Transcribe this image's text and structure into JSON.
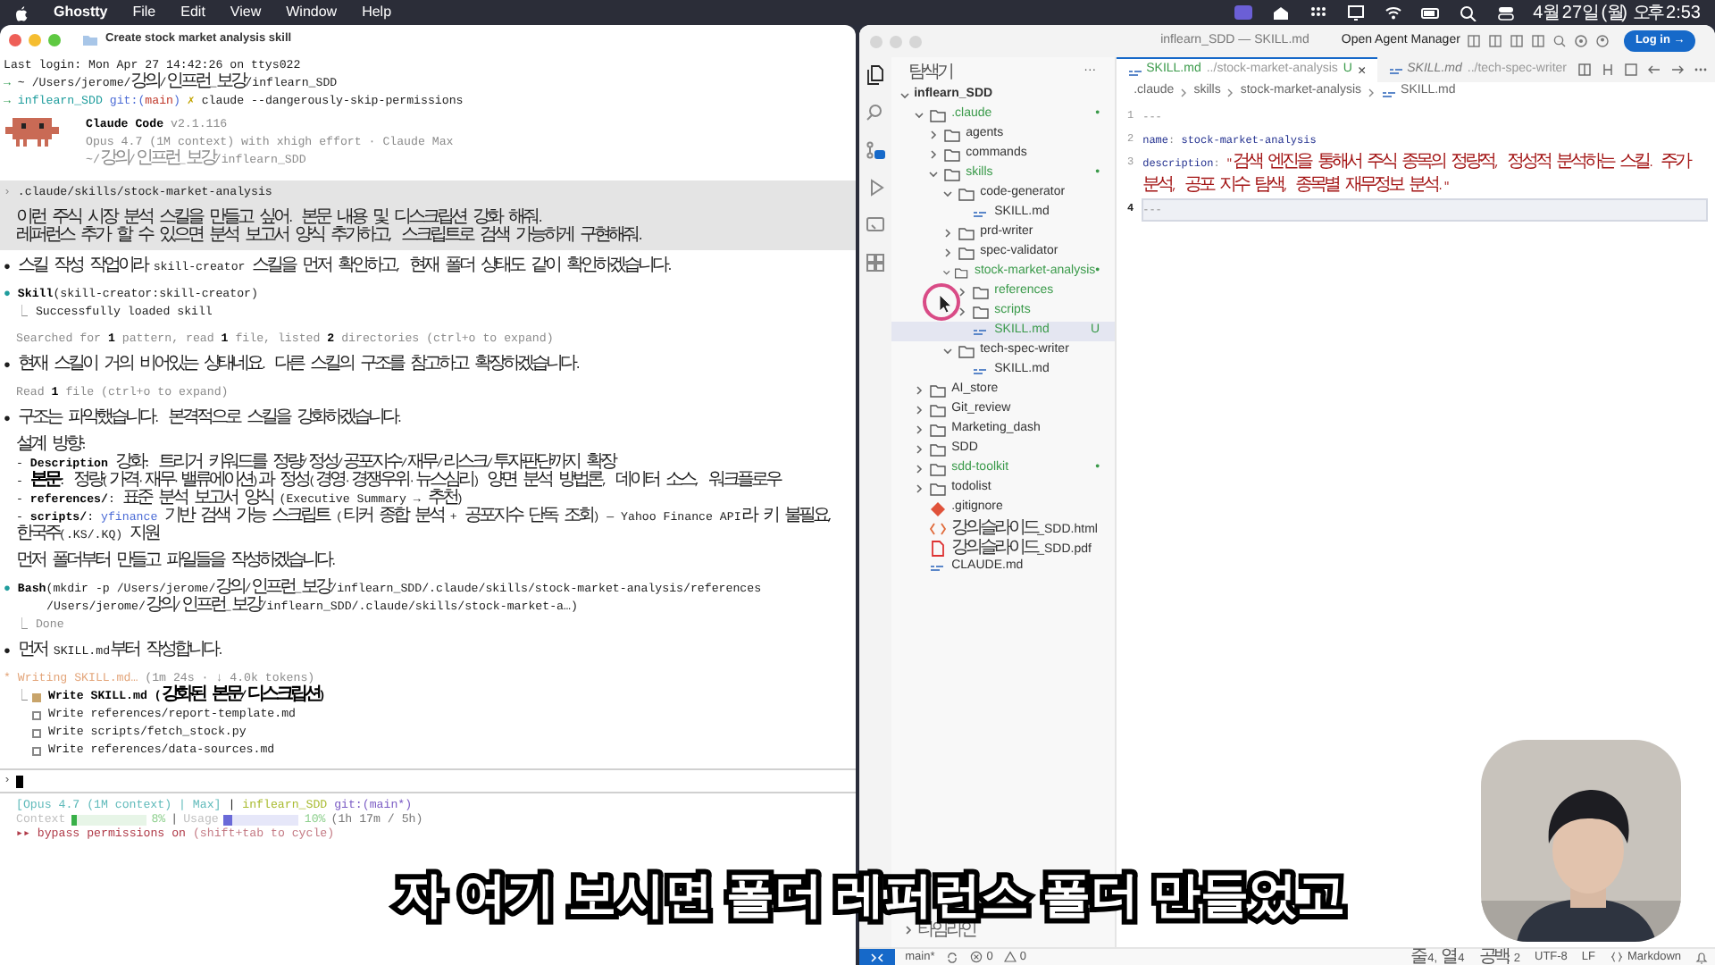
{
  "menubar": {
    "app": "Ghostty",
    "items": [
      "File",
      "Edit",
      "View",
      "Window",
      "Help"
    ],
    "clock": "4월 27일 (월) 오후 2:53"
  },
  "terminal": {
    "title": "Create stock market analysis skill",
    "session": [
      {
        "kind": "flush",
        "segs": [
          {
            "text": "Last login: Mon Apr 27 14:42:26 on ttys022",
            "kind": "plain"
          }
        ]
      },
      {
        "kind": "flush",
        "segs": [
          {
            "text": "→ ",
            "kind": "green"
          },
          {
            "text": "~ /Users/jerome/강의/인프런_보강/inflearn_SDD",
            "kind": "plain"
          }
        ]
      },
      {
        "kind": "flush",
        "segs": [
          {
            "text": "→ ",
            "kind": "green"
          },
          {
            "text": "inflearn_SDD",
            "kind": "teal"
          },
          {
            "text": " git:(",
            "kind": "blue"
          },
          {
            "text": "main",
            "kind": "red"
          },
          {
            "text": ")",
            "kind": "blue"
          },
          {
            "text": " ✗ ",
            "kind": "yellow"
          },
          {
            "text": "claude --dangerously-skip-permissions",
            "kind": "plain"
          }
        ]
      }
    ],
    "banner": [
      {
        "kind": "flush",
        "segs": [
          {
            "text": "Claude Code",
            "kind": "bold"
          },
          {
            "text": " v2.1.116",
            "kind": "dim"
          }
        ]
      },
      {
        "kind": "flush",
        "segs": [
          {
            "text": "Opus 4.7 (1M context) with xhigh effort · Claude Max",
            "kind": "dim"
          }
        ]
      },
      {
        "kind": "flush",
        "segs": [
          {
            "text": "~/강의/인프런_보강/inflearn_SDD",
            "kind": "dim"
          }
        ]
      }
    ],
    "prompt": [
      [
        {
          "kind": "flush",
          "segs": [
            {
              "text": "› ",
              "kind": "dim"
            },
            {
              "text": ".claude/skills/stock-market-analysis",
              "kind": "plain"
            }
          ]
        }
      ],
      [
        {
          "kind": "indent",
          "segs": [
            {
              "text": "이런 주식 시장 분석 스킬을 만들고 싶어. 본문 내용 및 디스크립션 강화 해줘.",
              "kind": "plain"
            }
          ]
        },
        {
          "kind": "indent",
          "segs": [
            {
              "text": "레퍼런스 추가 할 수 있으면 분석 보고서 양식 추가하고, 스크립트로 검색 가능하게 구현해줘.",
              "kind": "plain"
            }
          ]
        }
      ]
    ],
    "blocks": [
      [
        {
          "kind": "flush",
          "segs": [
            {
              "text": "● ",
              "kind": "plain"
            },
            {
              "text": "스킬 작성 작업이라 skill-creator 스킬을 먼저 확인하고, 현재 폴더 상태도 같이 확인하겠습니다.",
              "kind": "plain"
            }
          ]
        }
      ],
      [
        {
          "kind": "flush",
          "segs": [
            {
              "text": "● ",
              "kind": "teal"
            },
            {
              "text": "Skill",
              "kind": "bold"
            },
            {
              "text": "(skill-creator:skill-creator)",
              "kind": "plain"
            }
          ]
        },
        {
          "kind": "indent",
          "segs": [
            {
              "text": "⎿ ",
              "kind": "dim"
            },
            {
              "text": "Successfully loaded skill",
              "kind": "plain"
            }
          ]
        }
      ],
      [
        {
          "kind": "indent",
          "segs": [
            {
              "text": "Searched for ",
              "kind": "dim"
            },
            {
              "text": "1",
              "kind": "bold"
            },
            {
              "text": " pattern, read ",
              "kind": "dim"
            },
            {
              "text": "1",
              "kind": "bold"
            },
            {
              "text": " file, listed ",
              "kind": "dim"
            },
            {
              "text": "2",
              "kind": "bold"
            },
            {
              "text": " directories (ctrl+o to expand)",
              "kind": "dim"
            }
          ]
        }
      ],
      [
        {
          "kind": "flush",
          "segs": [
            {
              "text": "● ",
              "kind": "plain"
            },
            {
              "text": "현재 스킬이 거의 비어있는 상태네요. 다른 스킬의 구조를 참고하고 확장하겠습니다.",
              "kind": "plain"
            }
          ]
        }
      ],
      [
        {
          "kind": "indent",
          "segs": [
            {
              "text": "Read ",
              "kind": "dim"
            },
            {
              "text": "1",
              "kind": "bold"
            },
            {
              "text": " file (ctrl+o to expand)",
              "kind": "dim"
            }
          ]
        }
      ],
      [
        {
          "kind": "flush",
          "segs": [
            {
              "text": "● ",
              "kind": "plain"
            },
            {
              "text": "구조는 파악했습니다. 본격적으로 스킬을 강화하겠습니다.",
              "kind": "plain"
            }
          ]
        }
      ],
      [
        {
          "kind": "indent",
          "segs": [
            {
              "text": "설계 방향:",
              "kind": "plain"
            }
          ]
        },
        {
          "kind": "indent",
          "segs": [
            {
              "text": "- ",
              "kind": "plain"
            },
            {
              "text": "Description",
              "kind": "bold"
            },
            {
              "text": " 강화: 트리거 키워드를 정량/정성/공포지수/재무/리스크/투자판단까지 확장",
              "kind": "plain"
            }
          ]
        },
        {
          "kind": "indent",
          "segs": [
            {
              "text": "- ",
              "kind": "plain"
            },
            {
              "text": "본문",
              "kind": "bold"
            },
            {
              "text": ": 정량(가격·재무·밸류에이션)과 정성(경영·경쟁우위·뉴스심리) 양면 분석 방법론, 데이터 소스, 워크플로우",
              "kind": "plain"
            }
          ]
        },
        {
          "kind": "indent",
          "segs": [
            {
              "text": "- ",
              "kind": "plain"
            },
            {
              "text": "references/",
              "kind": "bold"
            },
            {
              "text": ": 표준 분석 보고서 양식 (Executive Summary → 추천)",
              "kind": "plain"
            }
          ]
        },
        {
          "kind": "indent",
          "segs": [
            {
              "text": "- ",
              "kind": "plain"
            },
            {
              "text": "scripts/",
              "kind": "bold"
            },
            {
              "text": ": ",
              "kind": "plain"
            },
            {
              "text": "yfinance",
              "kind": "blue"
            },
            {
              "text": " 기반 검색 가능 스크립트 (티커 종합 분석 + 공포지수 단독 조회) — Yahoo Finance API라 키 불필요,",
              "kind": "plain"
            }
          ]
        },
        {
          "kind": "indent",
          "segs": [
            {
              "text": "한국주(.KS/.KQ) 지원",
              "kind": "plain"
            }
          ]
        }
      ],
      [
        {
          "kind": "indent",
          "segs": [
            {
              "text": "먼저 폴더부터 만들고 파일들을 작성하겠습니다.",
              "kind": "plain"
            }
          ]
        }
      ],
      [
        {
          "kind": "flush",
          "segs": [
            {
              "text": "● ",
              "kind": "teal"
            },
            {
              "text": "Bash",
              "kind": "bold"
            },
            {
              "text": "(mkdir -p /Users/jerome/강의/인프런_보강/inflearn_SDD/.claude/skills/stock-market-analysis/references",
              "kind": "plain"
            }
          ]
        },
        {
          "kind": "deep",
          "segs": [
            {
              "text": "/Users/jerome/강의/인프런_보강/inflearn_SDD/.claude/skills/stock-market-a…)",
              "kind": "plain"
            }
          ]
        },
        {
          "kind": "indent",
          "segs": [
            {
              "text": "⎿ ",
              "kind": "dim"
            },
            {
              "text": "Done",
              "kind": "dim"
            }
          ]
        }
      ],
      [
        {
          "kind": "flush",
          "segs": [
            {
              "text": "● ",
              "kind": "plain"
            },
            {
              "text": "먼저 SKILL.md부터 작성합니다.",
              "kind": "plain"
            }
          ]
        }
      ],
      [
        {
          "kind": "flush",
          "segs": [
            {
              "text": "* Writing SKILL.md… ",
              "kind": "orange"
            },
            {
              "text": "(1m 24s · ↓ 4.0k tokens)",
              "kind": "dim"
            }
          ]
        }
      ]
    ],
    "todo_prefix": "⎿",
    "todos": [
      {
        "text": "Write SKILL.md (강화된 본문/디스크립션)",
        "active": true
      },
      {
        "text": "Write references/report-template.md",
        "active": false
      },
      {
        "text": "Write scripts/fetch_stock.py",
        "active": false
      },
      {
        "text": "Write references/data-sources.md",
        "active": false
      }
    ],
    "input": {
      "prompt": "›"
    },
    "statusline": {
      "segs": [
        {
          "text": "[Opus 4.7 (1M context) | Max]",
          "kind": "cyan"
        },
        {
          "text": " | ",
          "kind": "plain"
        },
        {
          "text": "inflearn_SDD",
          "kind": "lime"
        },
        {
          "text": " git:(main*)",
          "kind": "purple"
        }
      ],
      "meters": [
        {
          "label": "Context",
          "level": 0.08,
          "reading": "8%",
          "kind": "context"
        },
        {
          "label": "Usage",
          "level": 0.1,
          "reading": "10%",
          "kind": "usage"
        }
      ],
      "divider": "|",
      "extra": "(1h 17m / 5h)"
    },
    "mode": {
      "segs": [
        {
          "text": "▸▸ bypass permissions on",
          "kind": "rose"
        },
        {
          "text": " (shift+tab to cycle)",
          "kind": "rosedim"
        }
      ]
    }
  },
  "vscode": {
    "title": "inflearn_SDD — SKILL.md",
    "agent_button": "Open Agent Manager",
    "login": "Log in →",
    "activity": [
      {
        "kind": "files",
        "selected": true
      },
      {
        "kind": "search",
        "selected": false
      },
      {
        "kind": "source-control",
        "selected": false
      },
      {
        "kind": "run",
        "selected": false
      },
      {
        "kind": "remote",
        "selected": false
      },
      {
        "kind": "extensions",
        "selected": false
      }
    ],
    "explorer": {
      "title": "탐색기",
      "more": "···",
      "tree": [
        {
          "name": "inflearn_SDD",
          "kind": "root",
          "expanded": true,
          "changed": false,
          "selected": false,
          "children": [
            {
              "name": ".claude",
              "kind": "folder",
              "expanded": true,
              "changed": true,
              "badge": "•",
              "selected": false,
              "children": [
                {
                  "name": "agents",
                  "kind": "folder",
                  "expanded": false,
                  "changed": false,
                  "selected": false
                },
                {
                  "name": "commands",
                  "kind": "folder",
                  "expanded": false,
                  "changed": false,
                  "selected": false
                },
                {
                  "name": "skills",
                  "kind": "folder",
                  "expanded": true,
                  "changed": true,
                  "badge": "•",
                  "selected": false,
                  "children": [
                    {
                      "name": "code-generator",
                      "kind": "folder",
                      "expanded": true,
                      "changed": false,
                      "selected": false,
                      "children": [
                        {
                          "name": "SKILL.md",
                          "kind": "md",
                          "changed": false,
                          "selected": false
                        }
                      ]
                    },
                    {
                      "name": "prd-writer",
                      "kind": "folder",
                      "expanded": false,
                      "changed": false,
                      "selected": false
                    },
                    {
                      "name": "spec-validator",
                      "kind": "folder",
                      "expanded": false,
                      "changed": false,
                      "selected": false
                    },
                    {
                      "name": "stock-market-analysis",
                      "kind": "folder",
                      "expanded": true,
                      "changed": true,
                      "badge": "•",
                      "selected": false,
                      "children": [
                        {
                          "name": "references",
                          "kind": "folder",
                          "expanded": false,
                          "changed": true,
                          "selected": false
                        },
                        {
                          "name": "scripts",
                          "kind": "folder",
                          "expanded": false,
                          "changed": true,
                          "selected": false
                        },
                        {
                          "name": "SKILL.md",
                          "kind": "md",
                          "changed": true,
                          "badge": "U",
                          "selected": true
                        }
                      ]
                    },
                    {
                      "name": "tech-spec-writer",
                      "kind": "folder",
                      "expanded": true,
                      "changed": false,
                      "selected": false,
                      "children": [
                        {
                          "name": "SKILL.md",
                          "kind": "md",
                          "changed": false,
                          "selected": false
                        }
                      ]
                    }
                  ]
                }
              ]
            },
            {
              "name": "AI_store",
              "kind": "folder",
              "expanded": false,
              "changed": false,
              "selected": false
            },
            {
              "name": "Git_review",
              "kind": "folder",
              "expanded": false,
              "changed": false,
              "selected": false
            },
            {
              "name": "Marketing_dash",
              "kind": "folder",
              "expanded": false,
              "changed": false,
              "selected": false
            },
            {
              "name": "SDD",
              "kind": "folder",
              "expanded": false,
              "changed": false,
              "selected": false
            },
            {
              "name": "sdd-toolkit",
              "kind": "folder",
              "expanded": false,
              "changed": true,
              "badge": "•",
              "selected": false
            },
            {
              "name": "todolist",
              "kind": "folder",
              "expanded": false,
              "changed": false,
              "selected": false
            },
            {
              "name": ".gitignore",
              "kind": "git",
              "changed": false,
              "selected": false
            },
            {
              "name": "강의슬라이드_SDD.html",
              "kind": "html",
              "changed": false,
              "selected": false
            },
            {
              "name": "강의슬라이드_SDD.pdf",
              "kind": "pdf",
              "changed": false,
              "selected": false
            },
            {
              "name": "CLAUDE.md",
              "kind": "md",
              "changed": false,
              "selected": false
            }
          ]
        }
      ]
    },
    "timeline": "타임라인",
    "tabs": [
      {
        "name": "SKILL.md",
        "path": "../stock-market-analysis",
        "badge": "U",
        "close": "×",
        "selected": true
      },
      {
        "name": "SKILL.md",
        "path": "../tech-spec-writer",
        "selected": false
      }
    ],
    "breadcrumb": [
      ".claude",
      "skills",
      "stock-market-analysis",
      "SKILL.md"
    ],
    "code": [
      {
        "n": "1",
        "current": false,
        "segs": [
          {
            "text": "---",
            "kind": "punct"
          }
        ]
      },
      {
        "n": "2",
        "current": false,
        "segs": [
          {
            "text": "name",
            "kind": "key"
          },
          {
            "text": ": ",
            "kind": "punct"
          },
          {
            "text": "stock-market-analysis",
            "kind": "value"
          }
        ]
      },
      {
        "n": "3",
        "current": false,
        "segs": [
          {
            "text": "description",
            "kind": "key"
          },
          {
            "text": ": ",
            "kind": "punct"
          },
          {
            "text": "\"검색 엔진을 통해서 주식 종목의 정량적, 정성적 분석하는 스킬. 주가",
            "kind": "string"
          }
        ]
      },
      {
        "current": false,
        "segs": [
          {
            "text": "분석, 공포 지수 탐색, 종목별 재무정보 분석.\"",
            "kind": "string"
          }
        ]
      },
      {
        "n": "4",
        "current": true,
        "segs": [
          {
            "text": "---",
            "kind": "punct"
          }
        ]
      }
    ],
    "statusbar": {
      "branch": "main*",
      "errors": "0",
      "warnings": "0",
      "items": [
        "줄 4, 열 4",
        "공백: 2",
        "UTF-8",
        "LF"
      ],
      "language": "Markdown"
    }
  },
  "subtitle": "자 여기 보시면 폴더 레퍼런스 폴더 만들었고"
}
